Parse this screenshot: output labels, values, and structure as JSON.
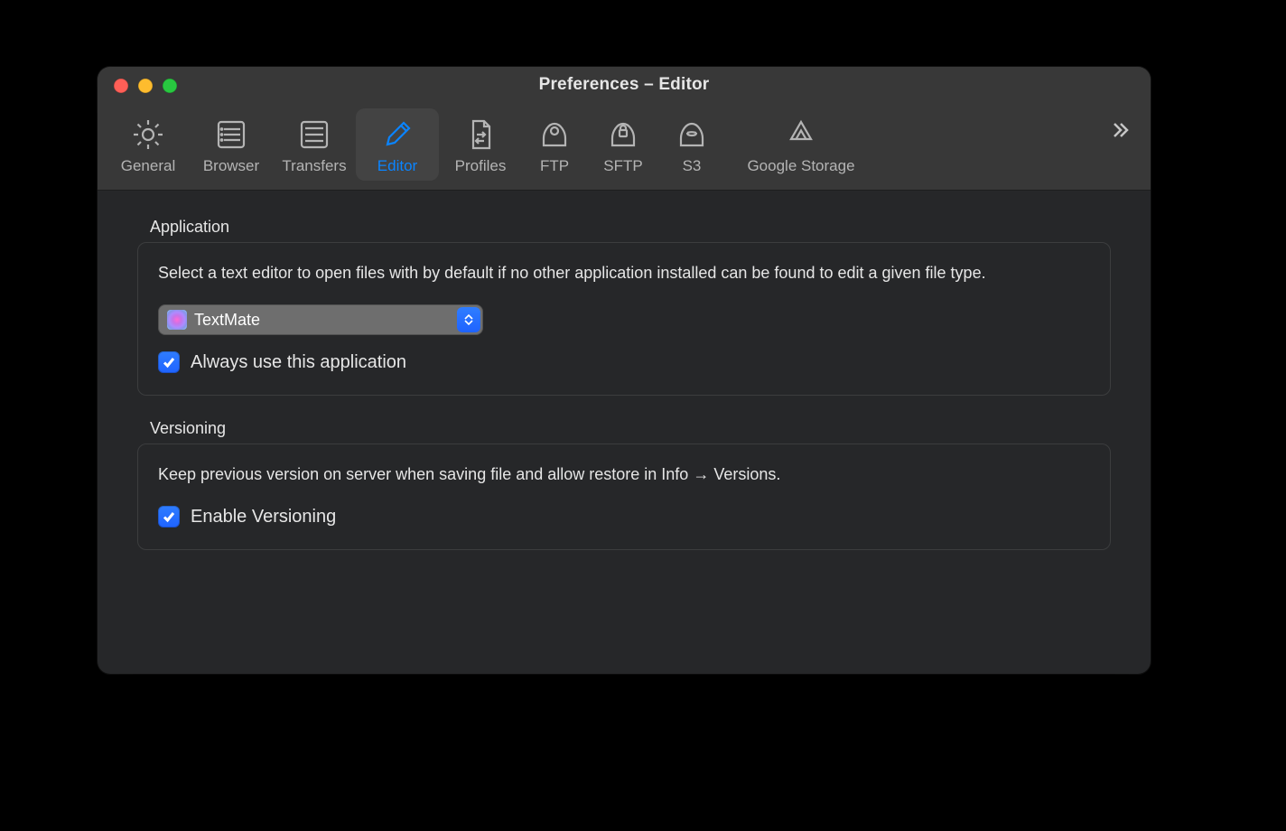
{
  "window": {
    "title": "Preferences – Editor"
  },
  "toolbar": {
    "items": [
      {
        "id": "general",
        "label": "General"
      },
      {
        "id": "browser",
        "label": "Browser"
      },
      {
        "id": "transfers",
        "label": "Transfers"
      },
      {
        "id": "editor",
        "label": "Editor",
        "selected": true
      },
      {
        "id": "profiles",
        "label": "Profiles"
      },
      {
        "id": "ftp",
        "label": "FTP"
      },
      {
        "id": "sftp",
        "label": "SFTP"
      },
      {
        "id": "s3",
        "label": "S3"
      },
      {
        "id": "google-storage",
        "label": "Google Storage"
      }
    ],
    "overflow": true
  },
  "sections": {
    "application": {
      "title": "Application",
      "description": "Select a text editor to open files with by default if no other application installed can be found to edit a given file type.",
      "selected_app": "TextMate",
      "checkbox": {
        "label": "Always use this application",
        "checked": true
      }
    },
    "versioning": {
      "title": "Versioning",
      "description": "Keep previous version on server when saving file and allow restore in Info → Versions.",
      "checkbox": {
        "label": "Enable Versioning",
        "checked": true
      }
    }
  }
}
